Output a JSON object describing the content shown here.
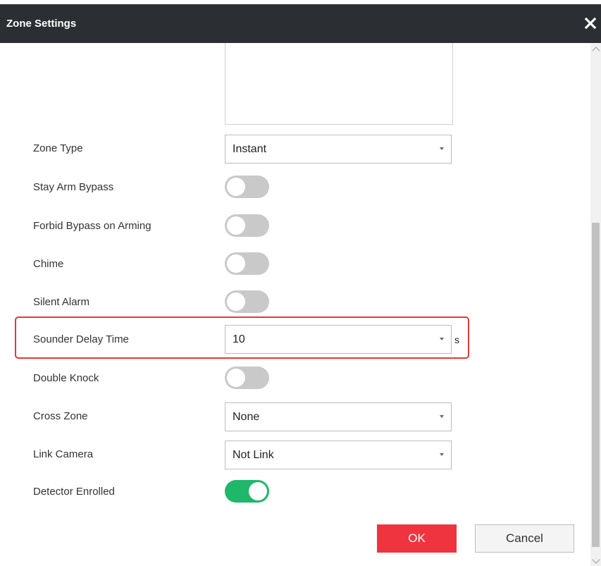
{
  "dialog": {
    "title": "Zone Settings",
    "close_icon": "close-icon"
  },
  "fields": {
    "zone_type": {
      "label": "Zone Type",
      "value": "Instant"
    },
    "stay_arm_bypass": {
      "label": "Stay Arm Bypass",
      "enabled": false
    },
    "forbid_bypass": {
      "label": "Forbid Bypass on Arming",
      "enabled": false
    },
    "chime": {
      "label": "Chime",
      "enabled": false
    },
    "silent_alarm": {
      "label": "Silent Alarm",
      "enabled": false
    },
    "sounder_delay": {
      "label": "Sounder Delay Time",
      "value": "10",
      "unit": "s"
    },
    "double_knock": {
      "label": "Double Knock",
      "enabled": false
    },
    "cross_zone": {
      "label": "Cross Zone",
      "value": "None"
    },
    "link_camera": {
      "label": "Link Camera",
      "value": "Not Link"
    },
    "detector_enrolled": {
      "label": "Detector Enrolled",
      "enabled": true
    }
  },
  "buttons": {
    "ok": "OK",
    "cancel": "Cancel"
  },
  "colors": {
    "titlebar": "#2b2f33",
    "ok": "#f0343f",
    "toggle_on": "#1fb86a",
    "toggle_off": "#c9c9c9",
    "highlight": "#e53935"
  }
}
